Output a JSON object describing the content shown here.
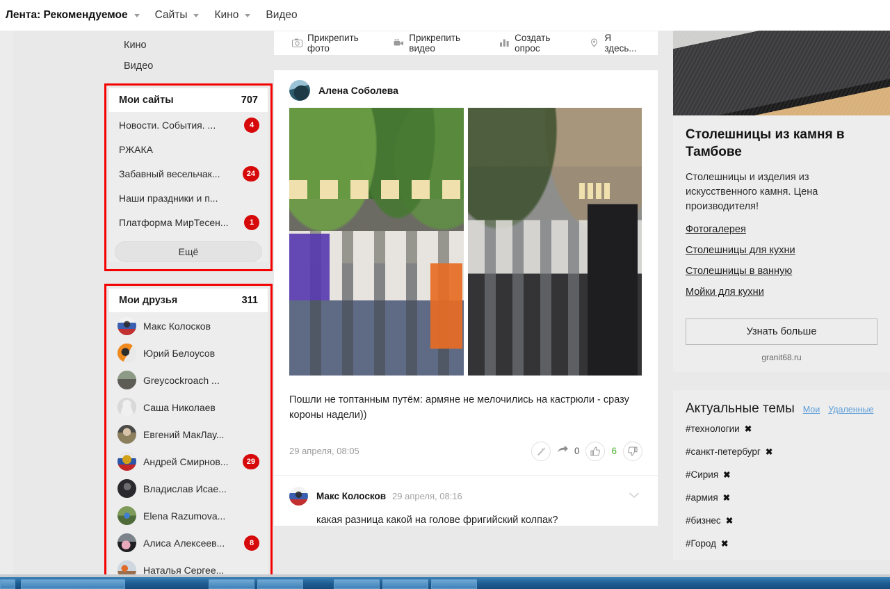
{
  "topnav": {
    "items": [
      {
        "label": "Лента: Рекомендуемое",
        "caret": true,
        "primary": true
      },
      {
        "label": "Сайты",
        "caret": true,
        "primary": false
      },
      {
        "label": "Кино",
        "caret": true,
        "primary": false
      },
      {
        "label": "Видео",
        "caret": false,
        "primary": false
      }
    ]
  },
  "left": {
    "pre_items": [
      {
        "label": "Кино"
      },
      {
        "label": "Видео"
      }
    ],
    "sites_panel": {
      "title": "Мои сайты",
      "count": "707",
      "items": [
        {
          "name": "Новости. События. ...",
          "badge": "4"
        },
        {
          "name": "РЖАКА",
          "badge": ""
        },
        {
          "name": "Забавный весельчак...",
          "badge": "24"
        },
        {
          "name": "Наши праздники и п...",
          "badge": ""
        },
        {
          "name": "Платформа МирТесен...",
          "badge": "1"
        }
      ],
      "more_label": "Ещё"
    },
    "friends_panel": {
      "title": "Мои друзья",
      "count": "311",
      "items": [
        {
          "name": "Макс Колосков",
          "badge": "",
          "avatar": "flag-ru-person"
        },
        {
          "name": "Юрий Белоусов",
          "badge": "",
          "avatar": "orange-portrait"
        },
        {
          "name": "Greycockroach ...",
          "badge": "",
          "avatar": "grey-outdoor"
        },
        {
          "name": "Саша Николаев",
          "badge": "",
          "avatar": "default-silhouette"
        },
        {
          "name": "Евгений МакЛау...",
          "badge": "",
          "avatar": "elder-man"
        },
        {
          "name": "Андрей Смирнов...",
          "badge": "29",
          "avatar": "ru-coat-of-arms"
        },
        {
          "name": "Владислав Исае...",
          "badge": "",
          "avatar": "dark-portrait"
        },
        {
          "name": "Elena Razumova...",
          "badge": "",
          "avatar": "woman-outdoor"
        },
        {
          "name": "Алиса Алексеев...",
          "badge": "8",
          "avatar": "woman-pink"
        },
        {
          "name": "Наталья Сергее...",
          "badge": "",
          "avatar": "flowers-table"
        }
      ]
    }
  },
  "composer": {
    "items": [
      {
        "label": "Прикрепить фото",
        "icon": "camera-icon"
      },
      {
        "label": "Прикрепить видео",
        "icon": "video-camera-icon"
      },
      {
        "label": "Создать опрос",
        "icon": "bar-chart-icon"
      },
      {
        "label": "Я здесь...",
        "icon": "map-pin-icon"
      }
    ]
  },
  "post": {
    "author": "Алена Соболева",
    "images": [
      {
        "alt": "Протестующие в бумажных коронах на улице"
      },
      {
        "alt": "Сидящие на мостовой протестующие и женщина в короне"
      }
    ],
    "text": "Пошли не топтанным путём: армяне не мелочились на кастрюли - сразу короны надели))",
    "time": "29 апреля, 08:05",
    "actions": {
      "magic_icon": "magic-wand-icon",
      "share_icon": "share-arrow-icon",
      "share_count": "0",
      "like_icon": "thumbs-up-icon",
      "like_count": "6",
      "dislike_icon": "thumbs-down-icon"
    }
  },
  "comment": {
    "author": "Макс Колосков",
    "time": "29 апреля, 08:16",
    "text": "какая разница какой на голове фригийский колпак?",
    "chevron_icon": "chevron-down-icon"
  },
  "ad": {
    "image_alt": "Столешница из тёмного гранита",
    "title": "Столешницы из камня в Тамбове",
    "description": "Столешницы и изделия из искусственного камня. Цена производителя!",
    "links": [
      "Фотогалерея",
      "Столешницы для кухни",
      "Столешницы в ванную",
      "Мойки для кухни"
    ],
    "cta": "Узнать больше",
    "domain": "granit68.ru"
  },
  "topics": {
    "title": "Актуальные темы",
    "links": [
      "Мои",
      "Удаленные"
    ],
    "remove_glyph": "✖",
    "items": [
      "#технологии",
      "#санкт-петербург",
      "#Сирия",
      "#армия",
      "#бизнес",
      "#Город"
    ]
  },
  "colors": {
    "highlight_red": "#f40000",
    "badge_red": "#d60a0a",
    "like_green": "#4caf2e",
    "link_blue": "#5b9dd9",
    "page_bg": "#e9e9e9",
    "card_bg": "#ffffff"
  }
}
